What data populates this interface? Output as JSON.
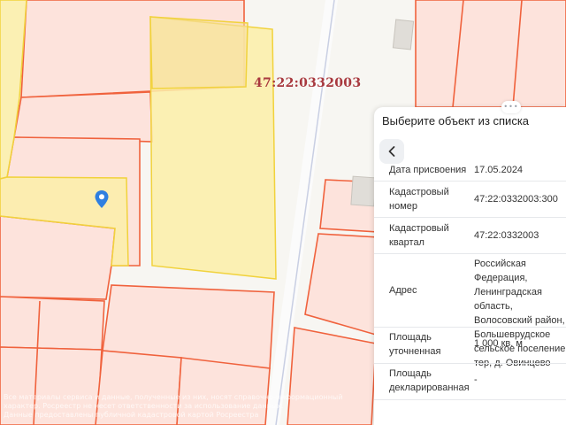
{
  "map": {
    "quarter_label": "47:22:0332003",
    "footer_line1": "Все материалы сервиса и данные, полученные из них, носят справочно-информационный характер. Росреестр не несет ответственности за использование данных.",
    "footer_line2": "Данные предоставлены публичной кадастровой картой Росреестра",
    "colors": {
      "parcel_fill": "#fde3dc",
      "parcel_stroke": "#f0623d",
      "selected_fill": "#fbefa8",
      "selected_stroke": "#f1d23c",
      "pin": "#2f7fe0"
    }
  },
  "panel": {
    "title": "Выберите объект из списка",
    "back_icon": "chevron-left-icon",
    "rows": [
      {
        "label": "Дата присвоения",
        "value": "17.05.2024"
      },
      {
        "label": "Кадастровый номер",
        "value": "47:22:0332003:300"
      },
      {
        "label": "Кадастровый квартал",
        "value": "47:22:0332003"
      },
      {
        "label": "Адрес",
        "value": "Российская Федерация, Ленинградская область, Волосовский район, Большеврудское сельское поселение тер, д. Овинцево"
      },
      {
        "label": "Площадь уточненная",
        "value": "1 000 кв. м"
      },
      {
        "label": "Площадь декларированная",
        "value": "-"
      }
    ]
  }
}
